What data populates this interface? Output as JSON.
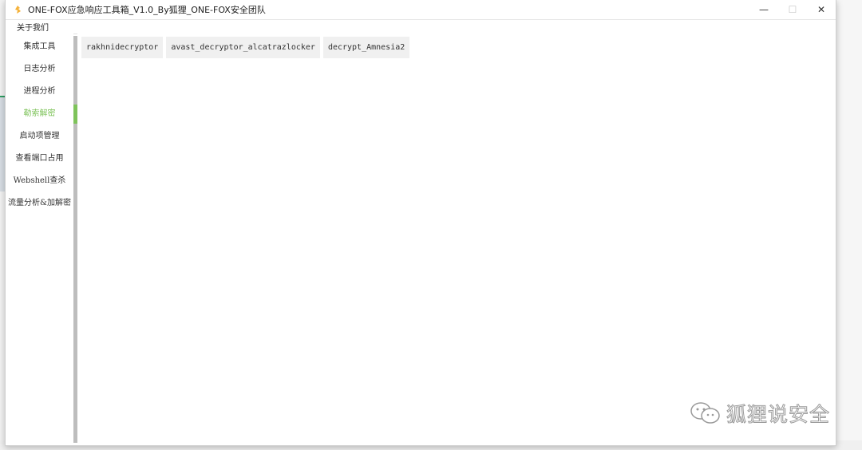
{
  "window": {
    "title": "ONE-FOX应急响应工具箱_V1.0_By狐狸_ONE-FOX安全团队",
    "controls": {
      "minimize": "—",
      "maximize": "☐",
      "close": "✕"
    }
  },
  "menubar": {
    "items": [
      {
        "label": "关于我们"
      }
    ]
  },
  "sidebar": {
    "items": [
      {
        "label": "集成工具",
        "active": false
      },
      {
        "label": "日志分析",
        "active": false
      },
      {
        "label": "进程分析",
        "active": false
      },
      {
        "label": "勒索解密",
        "active": true
      },
      {
        "label": "启动项管理",
        "active": false
      },
      {
        "label": "查看端口占用",
        "active": false
      },
      {
        "label": "Webshell查杀",
        "active": false
      },
      {
        "label": "流量分析&加解密",
        "active": false
      }
    ]
  },
  "content": {
    "tools": [
      {
        "label": "rakhnidecryptor"
      },
      {
        "label": "avast_decryptor_alcatrazlocker"
      },
      {
        "label": "decrypt_Amnesia2"
      }
    ]
  },
  "watermark": {
    "text": "狐狸说安全"
  },
  "colors": {
    "accent": "#7ec35a",
    "tab_bg": "#f0f0f0"
  }
}
